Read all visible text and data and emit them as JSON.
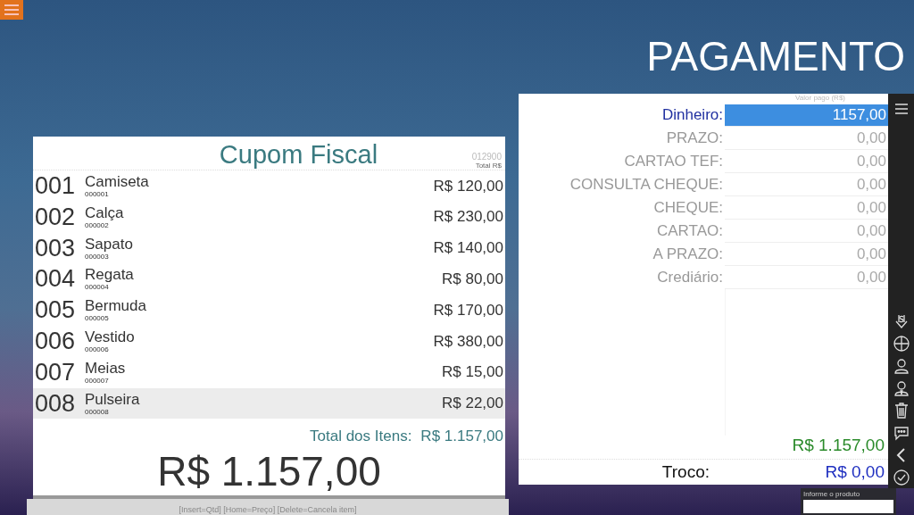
{
  "title": "PAGAMENTO",
  "receipt": {
    "title": "Cupom Fiscal",
    "code": "012900",
    "total_caption": "Total R$",
    "items": [
      {
        "number": "001",
        "name": "Camiseta",
        "code": "000001",
        "price": "R$ 120,00",
        "selected": false
      },
      {
        "number": "002",
        "name": "Calça",
        "code": "000002",
        "price": "R$ 230,00",
        "selected": false
      },
      {
        "number": "003",
        "name": "Sapato",
        "code": "000003",
        "price": "R$ 140,00",
        "selected": false
      },
      {
        "number": "004",
        "name": "Regata",
        "code": "000004",
        "price": "R$ 80,00",
        "selected": false
      },
      {
        "number": "005",
        "name": "Bermuda",
        "code": "000005",
        "price": "R$ 170,00",
        "selected": false
      },
      {
        "number": "006",
        "name": "Vestido",
        "code": "000006",
        "price": "R$ 380,00",
        "selected": false
      },
      {
        "number": "007",
        "name": "Meias",
        "code": "000007",
        "price": "R$ 15,00",
        "selected": false
      },
      {
        "number": "008",
        "name": "Pulseira",
        "code": "000008",
        "price": "R$ 22,00",
        "selected": true
      }
    ],
    "items_total_label": "Total dos Itens:",
    "items_total": "R$ 1.157,00",
    "grand_total": "R$ 1.157,00",
    "shortcuts": "[Insert=Qtd] [Home=Preço] [Delete=Cancela item]"
  },
  "payment": {
    "value_header": "Valor pago (R$)",
    "methods": [
      {
        "label": "Dinheiro:",
        "value": "1157,00",
        "selected": true
      },
      {
        "label": "PRAZO:",
        "value": "0,00",
        "selected": false
      },
      {
        "label": "CARTAO TEF:",
        "value": "0,00",
        "selected": false
      },
      {
        "label": "CONSULTA CHEQUE:",
        "value": "0,00",
        "selected": false
      },
      {
        "label": "CHEQUE:",
        "value": "0,00",
        "selected": false
      },
      {
        "label": "CARTAO:",
        "value": "0,00",
        "selected": false
      },
      {
        "label": "A PRAZO:",
        "value": "0,00",
        "selected": false
      },
      {
        "label": "Crediário:",
        "value": "0,00",
        "selected": false
      }
    ],
    "total": "R$ 1.157,00",
    "change_label": "Troco:",
    "change": "R$ 0,00"
  },
  "product_input": {
    "label": "Informe o produto"
  }
}
